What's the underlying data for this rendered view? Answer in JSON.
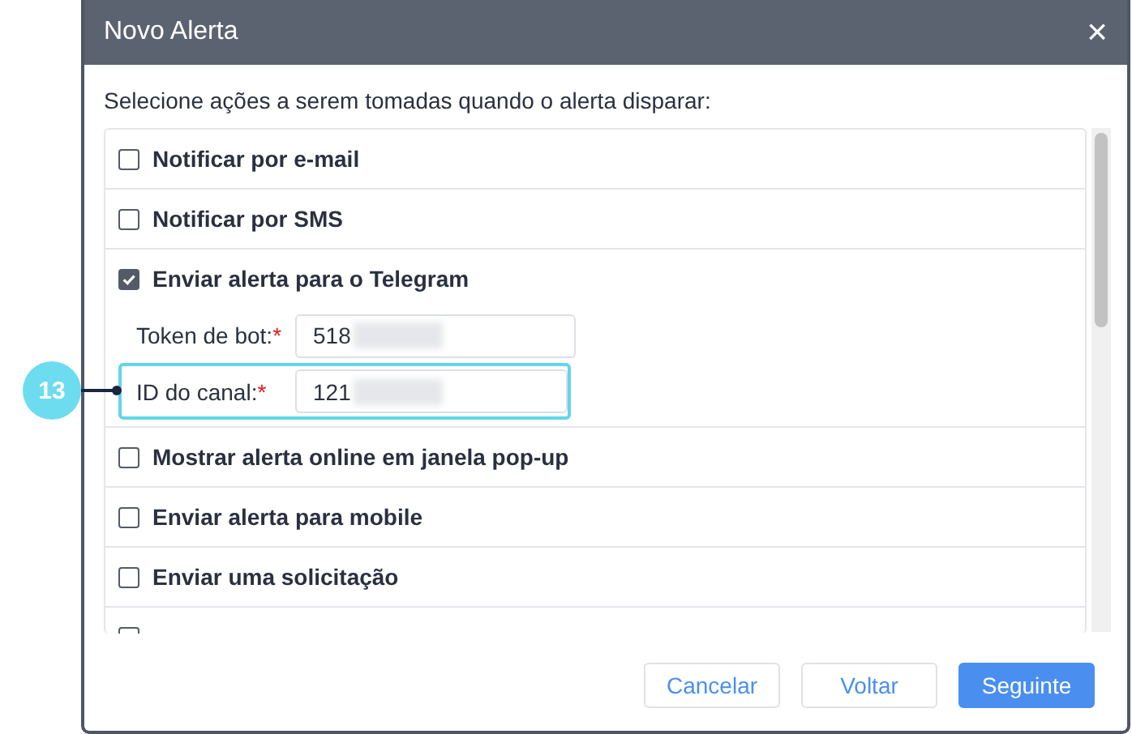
{
  "window": {
    "title": "Novo Alerta",
    "close": "×"
  },
  "instruction": "Selecione ações a serem tomadas quando o alerta disparar:",
  "actions": [
    {
      "kind": "checkbox",
      "label": "Notificar por e-mail",
      "checked": false
    },
    {
      "kind": "checkbox",
      "label": "Notificar por SMS",
      "checked": false
    },
    {
      "kind": "checkbox",
      "label": "Enviar alerta para o Telegram",
      "checked": true,
      "fields": [
        {
          "label": "Token de bot:",
          "required_mark": "*",
          "value": "518",
          "blurred": true,
          "highlighted": false
        },
        {
          "label": "ID do canal:",
          "required_mark": "*",
          "value": "121",
          "blurred": true,
          "highlighted": true,
          "callout": "13"
        }
      ]
    },
    {
      "kind": "checkbox",
      "label": "Mostrar alerta online em janela pop-up",
      "checked": false
    },
    {
      "kind": "checkbox",
      "label": "Enviar alerta para mobile",
      "checked": false
    },
    {
      "kind": "checkbox",
      "label": "Enviar uma solicitação",
      "checked": false
    },
    {
      "kind": "checkbox",
      "checked": false
    }
  ],
  "buttons": [
    {
      "label": "Cancelar",
      "primary": false
    },
    {
      "label": "Voltar",
      "primary": false
    },
    {
      "label": "Seguinte",
      "primary": true
    }
  ]
}
